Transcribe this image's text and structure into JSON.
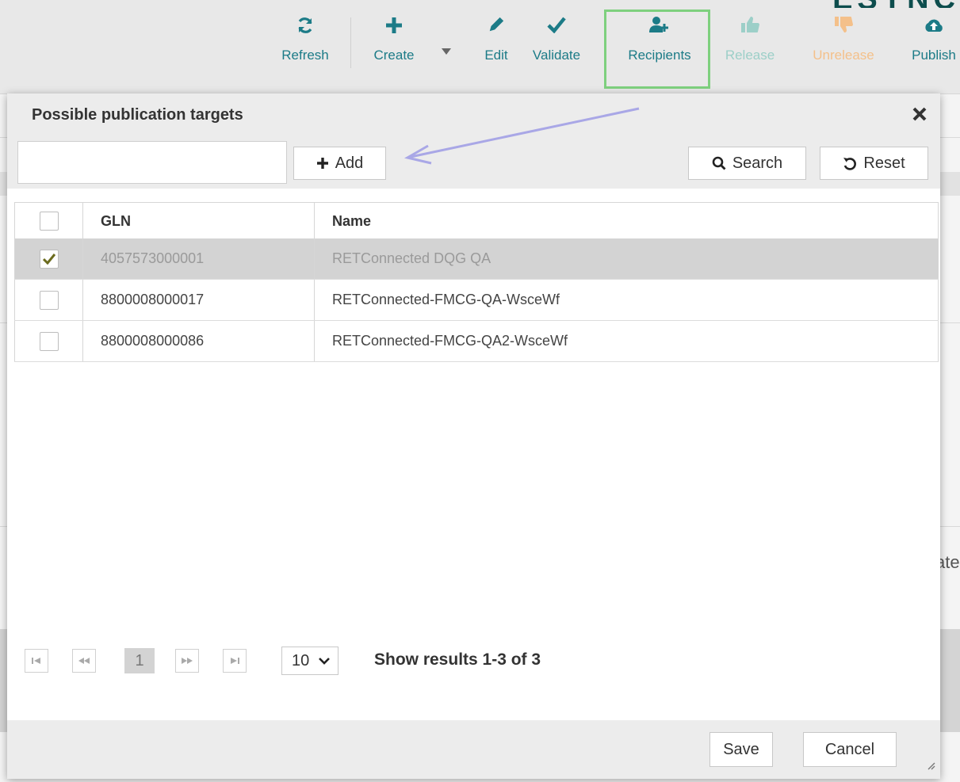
{
  "app": {
    "brand": "ESYNC",
    "toolbar": [
      {
        "label": "Refresh",
        "icon": "refresh-icon"
      },
      {
        "label": "Create",
        "icon": "plus-icon"
      },
      {
        "label": "Edit",
        "icon": "pencil-icon"
      },
      {
        "label": "Validate",
        "icon": "check-icon"
      },
      {
        "label": "Recipients",
        "icon": "users-icon"
      },
      {
        "label": "Release",
        "icon": "thumbs-up-icon"
      },
      {
        "label": "Unrelease",
        "icon": "thumbs-down-icon"
      },
      {
        "label": "Publish",
        "icon": "cloud-upload-icon"
      }
    ],
    "background_fragment": "ate"
  },
  "dialog": {
    "title": "Possible publication targets",
    "search": {
      "value": "",
      "placeholder": ""
    },
    "add_label": "Add",
    "search_label": "Search",
    "reset_label": "Reset",
    "grid": {
      "columns": [
        "GLN",
        "Name"
      ],
      "rows": [
        {
          "checked": true,
          "gln": "4057573000001",
          "name": "RETConnected DQG QA"
        },
        {
          "checked": false,
          "gln": "8800008000017",
          "name": "RETConnected-FMCG-QA-WsceWf"
        },
        {
          "checked": false,
          "gln": "8800008000086",
          "name": "RETConnected-FMCG-QA2-WsceWf"
        }
      ]
    },
    "pager": {
      "current_page": "1",
      "page_size": "10",
      "info": "Show results 1-3 of 3"
    },
    "save_label": "Save",
    "cancel_label": "Cancel"
  },
  "colors": {
    "toolbar_text": "#1c7b87",
    "highlight": "#7ed07e",
    "arrow": "#a9a7e6",
    "check": "#6b6b1e"
  }
}
